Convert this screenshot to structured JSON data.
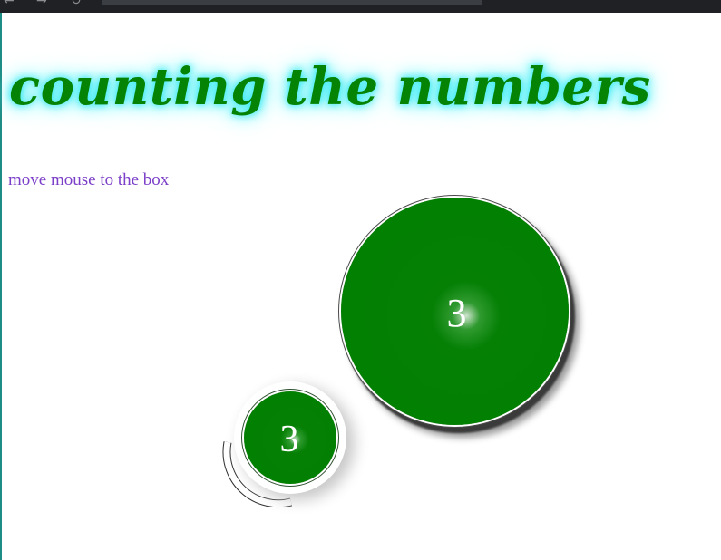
{
  "browser": {
    "back_icon": "back-arrow-icon",
    "forward_icon": "forward-arrow-icon",
    "reload_icon": "reload-icon"
  },
  "page": {
    "title": "counting the numbers",
    "instruction": "move mouse to the box"
  },
  "counters": {
    "big_value": "3",
    "small_value": "3"
  },
  "colors": {
    "title_green": "#058305",
    "title_glow": "#2ee8f0",
    "instruction_purple": "#7b3fc8",
    "circle_green": "#008000",
    "edge_teal": "#1d8c84"
  }
}
